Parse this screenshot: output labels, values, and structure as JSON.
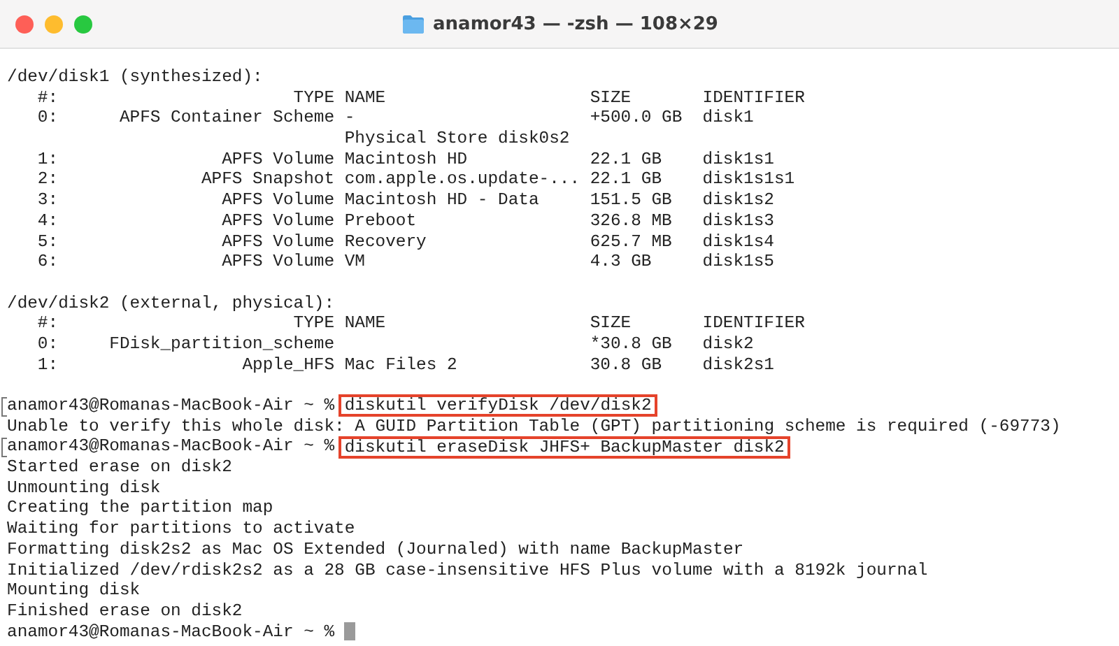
{
  "window": {
    "title": "anamor43 — -zsh — 108×29"
  },
  "lines": [
    {
      "kind": "text",
      "text": "/dev/disk1 (synthesized):"
    },
    {
      "kind": "table",
      "header": {
        "number": "#:",
        "type": "TYPE",
        "name": "NAME",
        "size": "SIZE",
        "identifier": "IDENTIFIER"
      },
      "rows": [
        {
          "number": "0:",
          "type": "APFS Container Scheme",
          "name": "-",
          "size": "+500.0 GB",
          "identifier": "disk1"
        },
        {
          "name": "Physical Store disk0s2"
        },
        {
          "number": "1:",
          "type": "APFS Volume",
          "name": "Macintosh HD",
          "size": "22.1 GB",
          "identifier": "disk1s1"
        },
        {
          "number": "2:",
          "type": "APFS Snapshot",
          "name": "com.apple.os.update-...",
          "size": "22.1 GB",
          "identifier": "disk1s1s1"
        },
        {
          "number": "3:",
          "type": "APFS Volume",
          "name": "Macintosh HD - Data",
          "size": "151.5 GB",
          "identifier": "disk1s2"
        },
        {
          "number": "4:",
          "type": "APFS Volume",
          "name": "Preboot",
          "size": "326.8 MB",
          "identifier": "disk1s3"
        },
        {
          "number": "5:",
          "type": "APFS Volume",
          "name": "Recovery",
          "size": "625.7 MB",
          "identifier": "disk1s4"
        },
        {
          "number": "6:",
          "type": "APFS Volume",
          "name": "VM",
          "size": "4.3 GB",
          "identifier": "disk1s5"
        }
      ]
    },
    {
      "kind": "blank"
    },
    {
      "kind": "text",
      "text": "/dev/disk2 (external, physical):"
    },
    {
      "kind": "table",
      "header": {
        "number": "#:",
        "type": "TYPE",
        "name": "NAME",
        "size": "SIZE",
        "identifier": "IDENTIFIER"
      },
      "rows": [
        {
          "number": "0:",
          "type": "FDisk_partition_scheme",
          "size": "*30.8 GB",
          "identifier": "disk2"
        },
        {
          "number": "1:",
          "type": "Apple_HFS",
          "name": "Mac Files 2",
          "size": "30.8 GB",
          "identifier": "disk2s1"
        }
      ]
    },
    {
      "kind": "blank"
    },
    {
      "kind": "prompt",
      "prompt": "anamor43@Romanas-MacBook-Air ~ %",
      "command": "diskutil verifyDisk /dev/disk2",
      "highlighted": true,
      "marked": true,
      "cursor": false
    },
    {
      "kind": "text",
      "text": "Unable to verify this whole disk: A GUID Partition Table (GPT) partitioning scheme is required (-69773)"
    },
    {
      "kind": "prompt",
      "prompt": "anamor43@Romanas-MacBook-Air ~ %",
      "command": "diskutil eraseDisk JHFS+ BackupMaster disk2",
      "highlighted": true,
      "marked": true,
      "cursor": false
    },
    {
      "kind": "text",
      "text": "Started erase on disk2"
    },
    {
      "kind": "text",
      "text": "Unmounting disk"
    },
    {
      "kind": "text",
      "text": "Creating the partition map"
    },
    {
      "kind": "text",
      "text": "Waiting for partitions to activate"
    },
    {
      "kind": "text",
      "text": "Formatting disk2s2 as Mac OS Extended (Journaled) with name BackupMaster"
    },
    {
      "kind": "text",
      "text": "Initialized /dev/rdisk2s2 as a 28 GB case-insensitive HFS Plus volume with a 8192k journal"
    },
    {
      "kind": "text",
      "text": "Mounting disk"
    },
    {
      "kind": "text",
      "text": "Finished erase on disk2"
    },
    {
      "kind": "prompt",
      "prompt": "anamor43@Romanas-MacBook-Air ~ %",
      "marked": false,
      "cursor": true
    }
  ]
}
